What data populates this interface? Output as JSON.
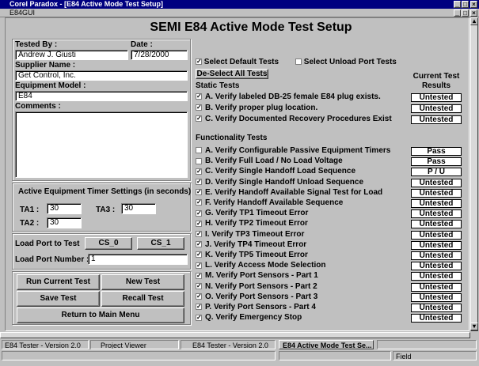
{
  "window": {
    "title": "Corel Paradox - [E84 Active Mode Test Setup]",
    "menu_title": "E84GUI",
    "controls": [
      "_",
      "□",
      "×"
    ]
  },
  "form": {
    "title": "SEMI E84 Active Mode Test Setup",
    "tested_by_label": "Tested By :",
    "tested_by_value": "Andrew J. Giusti",
    "date_label": "Date :",
    "date_value": "7/28/2000",
    "supplier_label": "Supplier Name :",
    "supplier_value": "Get Control, Inc.",
    "model_label": "Equipment Model :",
    "model_value": "E84",
    "comments_label": "Comments :",
    "comments_value": "",
    "timer_label": "Active Equipment Timer Settings (in seconds)",
    "ta1_label": "TA1 :",
    "ta1_value": "30",
    "ta3_label": "TA3 :",
    "ta3_value": "30",
    "ta2_label": "TA2 :",
    "ta2_value": "30",
    "load_port_label": "Load Port to Test",
    "cs0_label": "CS_0",
    "cs1_label": "CS_1",
    "load_port_number_label": "Load Port Number :",
    "load_port_number_value": "1",
    "buttons": {
      "run_current_test": "Run Current Test",
      "new_test": "New Test",
      "save_test": "Save Test",
      "recall_test": "Recall Test",
      "return_main": "Return to Main Menu"
    },
    "select_default_label": "Select Default Tests",
    "select_unload_label": "Select Unload Port Tests",
    "deselect_all_label": "De-Select All Tests",
    "results_header_1": "Current Test",
    "results_header_2": "Results",
    "static_tests_label": "Static Tests",
    "functionality_tests_label": "Functionality Tests"
  },
  "static_tests": [
    {
      "label": "A. Verify labeled DB-25 female E84 plug exists.",
      "checked": true,
      "result": "Untested"
    },
    {
      "label": "B. Verify proper plug location.",
      "checked": true,
      "result": "Untested"
    },
    {
      "label": "C. Verify Documented Recovery Procedures Exist",
      "checked": true,
      "result": "Untested"
    }
  ],
  "functionality_tests": [
    {
      "label": "A. Verify Configurable Passive Equipment Timers",
      "checked": false,
      "result": "Pass"
    },
    {
      "label": "B. Verify Full Load / No Load Voltage",
      "checked": false,
      "result": "Pass"
    },
    {
      "label": "C. Verify Single Handoff Load Sequence",
      "checked": true,
      "result": "P / U"
    },
    {
      "label": "D. Verify Single Handoff Unload Sequence",
      "checked": true,
      "result": "Untested"
    },
    {
      "label": "E. Verify Handoff Available Signal Test for Load",
      "checked": true,
      "result": "Untested"
    },
    {
      "label": "F. Verify Handoff Available Sequence",
      "checked": true,
      "result": "Untested"
    },
    {
      "label": "G. Verify TP1 Timeout Error",
      "checked": true,
      "result": "Untested"
    },
    {
      "label": "H. Verify TP2 Timeout Error",
      "checked": true,
      "result": "Untested"
    },
    {
      "label": "I. Verify TP3 Timeout Error",
      "checked": true,
      "result": "Untested"
    },
    {
      "label": "J. Verify TP4 Timeout Error",
      "checked": true,
      "result": "Untested"
    },
    {
      "label": "K. Verify TP5 Timeout Error",
      "checked": true,
      "result": "Untested"
    },
    {
      "label": "L. Verify Access Mode Selection",
      "checked": true,
      "result": "Untested"
    },
    {
      "label": "M. Verify Port Sensors - Part 1",
      "checked": true,
      "result": "Untested"
    },
    {
      "label": "N. Verify Port Sensors - Part 2",
      "checked": true,
      "result": "Untested"
    },
    {
      "label": "O. Verify Port Sensors - Part 3",
      "checked": true,
      "result": "Untested"
    },
    {
      "label": "P. Verify Port Sensors - Part 4",
      "checked": true,
      "result": "Untested"
    },
    {
      "label": "Q. Verify Emergency Stop",
      "checked": true,
      "result": "Untested"
    }
  ],
  "status": {
    "cell1": "E84 Tester - Version 2.0",
    "cell2": "Project Viewer",
    "cell3": "E84 Tester - Version 2.0",
    "cell4": "E84 Active Mode Test Se...",
    "field_label": "Field"
  },
  "colors": {
    "titlebar": "#000080",
    "face": "#c0c0c0"
  }
}
